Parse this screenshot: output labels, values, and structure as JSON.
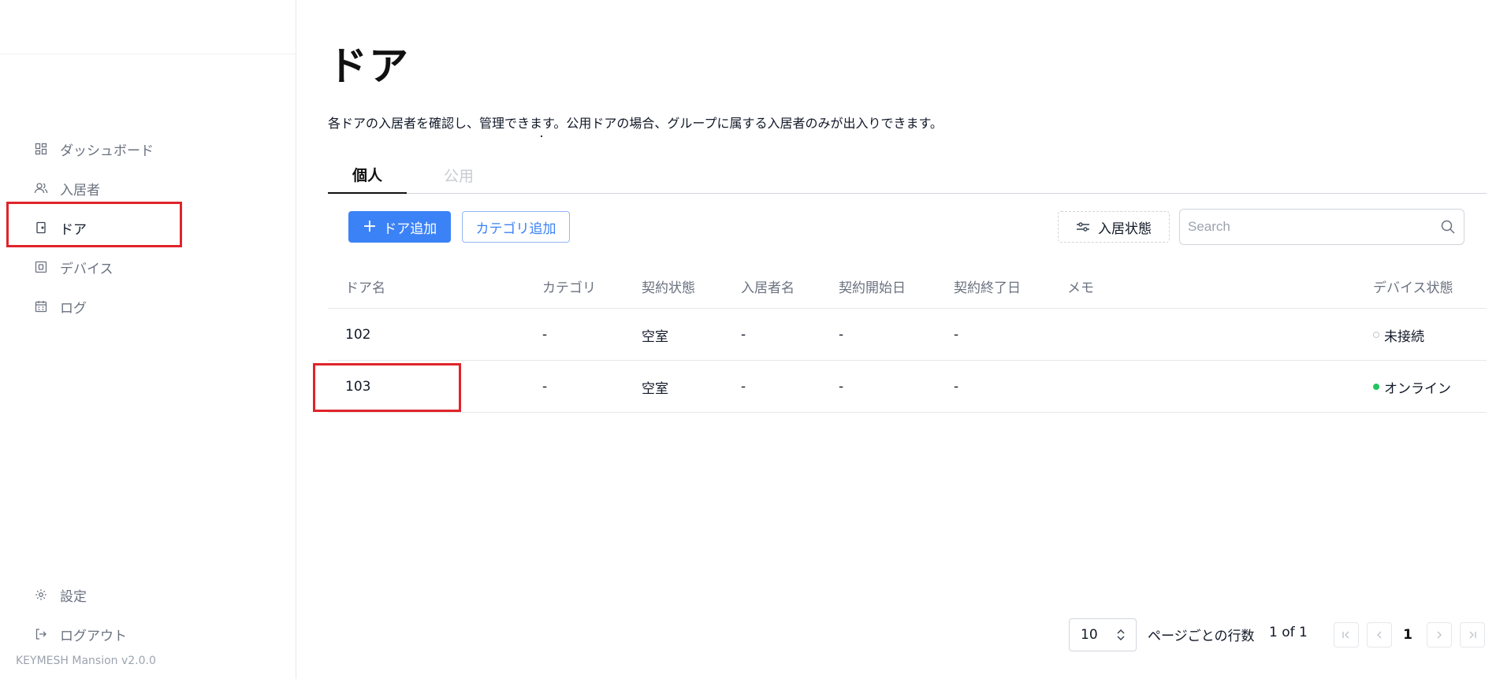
{
  "app": {
    "version": "KEYMESH Mansion v2.0.0"
  },
  "sidebar": {
    "items": [
      {
        "label": "ダッシュボード",
        "icon": "dashboard-icon"
      },
      {
        "label": "入居者",
        "icon": "users-icon"
      },
      {
        "label": "ドア",
        "icon": "door-icon",
        "active": true
      },
      {
        "label": "デバイス",
        "icon": "device-icon"
      },
      {
        "label": "ログ",
        "icon": "calendar-log-icon"
      }
    ],
    "bottom": [
      {
        "label": "設定",
        "icon": "gear-icon"
      },
      {
        "label": "ログアウト",
        "icon": "logout-icon"
      }
    ]
  },
  "page": {
    "title": "ドア",
    "description": "各ドアの入居者を確認し、管理できます。公用ドアの場合、グループに属する入居者のみが出入りできます。"
  },
  "tabs": [
    {
      "label": "個人",
      "active": true
    },
    {
      "label": "公用",
      "active": false
    }
  ],
  "toolbar": {
    "add_door": "ドア追加",
    "add_category": "カテゴリ追加",
    "filter": "入居状態",
    "search_placeholder": "Search"
  },
  "table": {
    "columns": [
      "ドア名",
      "カテゴリ",
      "契約状態",
      "入居者名",
      "契約開始日",
      "契約終了日",
      "メモ",
      "デバイス状態"
    ],
    "rows": [
      {
        "name": "102",
        "category": "-",
        "contract": "空室",
        "resident": "-",
        "start": "-",
        "end": "-",
        "memo": "",
        "device": "未接続",
        "device_state": "offline"
      },
      {
        "name": "103",
        "category": "-",
        "contract": "空室",
        "resident": "-",
        "start": "-",
        "end": "-",
        "memo": "",
        "device": "オンライン",
        "device_state": "online"
      }
    ]
  },
  "pagination": {
    "rows_per_page": "10",
    "rows_per_page_label": "ページごとの行数",
    "page_info": "1 of 1",
    "current_page": "1"
  },
  "colors": {
    "accent": "#3b82f6",
    "online": "#22c55e",
    "highlight": "#e0242a"
  }
}
